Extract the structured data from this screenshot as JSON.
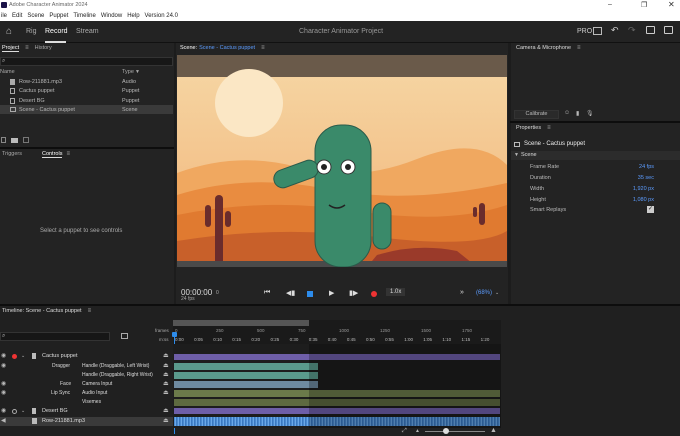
{
  "window": {
    "title": "Adobe Character Animator 2024"
  },
  "menu": [
    "ile",
    "Edit",
    "Scene",
    "Puppet",
    "Timeline",
    "Window",
    "Help",
    "Version 24.0"
  ],
  "header": {
    "tabs": [
      "Rig",
      "Record",
      "Stream"
    ],
    "active": "Record",
    "project_title": "Character Animator Project",
    "pro": "PRO"
  },
  "project": {
    "tab1": "Project",
    "tab2": "History",
    "col_name": "Name",
    "col_type": "Type",
    "items": [
      {
        "name": "Row-211881.mp3",
        "type": "Audio"
      },
      {
        "name": "Cactus puppet",
        "type": "Puppet"
      },
      {
        "name": "Desert BG",
        "type": "Puppet"
      },
      {
        "name": "Scene - Cactus puppet",
        "type": "Scene"
      }
    ]
  },
  "triggers": {
    "tab1": "Triggers",
    "tab2": "Controls",
    "message": "Select a puppet to see controls"
  },
  "scene": {
    "label": "Scene:",
    "name": "Scene - Cactus puppet",
    "timecode": "00:00:00",
    "frame": "0",
    "fps": "24 fps",
    "rate": "1.0x",
    "zoom": "(68%)"
  },
  "camera": {
    "title": "Camera & Microphone",
    "calibrate": "Calibrate"
  },
  "properties": {
    "title": "Properties",
    "scene_name": "Scene - Cactus puppet",
    "section": "Scene",
    "rows": [
      {
        "label": "Frame Rate",
        "value": "24 fps"
      },
      {
        "label": "Duration",
        "value": "35 sec"
      },
      {
        "label": "Width",
        "value": "1,920 px"
      },
      {
        "label": "Height",
        "value": "1,080 px"
      },
      {
        "label": "Smart Replays",
        "value": ""
      }
    ]
  },
  "timeline": {
    "title": "Timeline: Scene - Cactus puppet",
    "frames_label": "frames",
    "ms_label": "m:ss",
    "frame_ticks": [
      "0",
      "250",
      "500",
      "750",
      "1000",
      "1250",
      "1500",
      "1750"
    ],
    "time_ticks": [
      "0:00",
      "0:05",
      "0:10",
      "0:15",
      "0:20",
      "0:25",
      "0:30",
      "0:35",
      "0:40",
      "0:45",
      "0:50",
      "0:55",
      "1:00",
      "1:05",
      "1:10",
      "1:15",
      "1:20"
    ],
    "tracks": [
      {
        "group": "",
        "name": "Cactus puppet"
      },
      {
        "group": "Dragger",
        "name": "Handle (Draggable, Left Wrist)"
      },
      {
        "group": "",
        "name": "Handle (Draggable, Right Wrist)"
      },
      {
        "group": "Face",
        "name": "Camera Input"
      },
      {
        "group": "Lip Sync",
        "name": "Audio Input"
      },
      {
        "group": "",
        "name": "Visemes"
      },
      {
        "group": "",
        "name": "Desert BG"
      },
      {
        "group": "",
        "name": "Row-211881.mp3"
      }
    ]
  },
  "colors": {
    "accent": "#2d8ceb",
    "record": "#e33",
    "bar_green": "#5a9a8c",
    "bar_purple": "#8b78c8",
    "bar_olive": "#6b7a4a",
    "audio": "#4a8ad0",
    "cactus": "#3a8a6a"
  }
}
